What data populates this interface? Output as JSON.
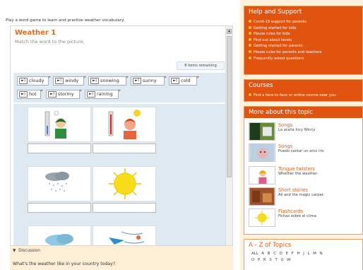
{
  "intro": "Play a word game to learn and practise weather vocabulary.",
  "game": {
    "title": "Weather 1",
    "instruction": "Match the word to the picture.",
    "remaining": "8 items remaining",
    "speaker_icon": "speaker-icon",
    "words": [
      "cloudy",
      "windy",
      "snowing",
      "sunny",
      "cold",
      "hot",
      "stormy",
      "raining"
    ]
  },
  "discussion": {
    "heading": "Discussion",
    "question": "What's the weather like in your country today?"
  },
  "help": {
    "title": "Help and Support",
    "items": [
      "Covid-19 support for parents",
      "Getting started for kids",
      "House rules for kids",
      "Find out about levels",
      "Getting started for parents",
      "House rules for parents and teachers",
      "Frequently asked questions"
    ]
  },
  "courses": {
    "title": "Courses",
    "link": "Find a face-to-face or online course near you."
  },
  "more": {
    "title": "More about this topic",
    "items": [
      {
        "title": "Songs",
        "sub": "La araña Incy Wincy"
      },
      {
        "title": "Songs",
        "sub": "Puedo cantar un arco iris"
      },
      {
        "title": "Tongue twisters",
        "sub": "Whether the weather"
      },
      {
        "title": "Short stories",
        "sub": "Ali and the magic carpet"
      },
      {
        "title": "Flashcards",
        "sub": "Fichas sobre el clima"
      }
    ]
  },
  "az": {
    "title": "A - Z of Topics",
    "row1": "ALL A B C D E F H J L M N",
    "row2": "O P R S T U W"
  },
  "colors": {
    "brand_orange": "#e05410",
    "title_orange": "#e06a1f",
    "bank_blue": "#dfe9f2"
  }
}
